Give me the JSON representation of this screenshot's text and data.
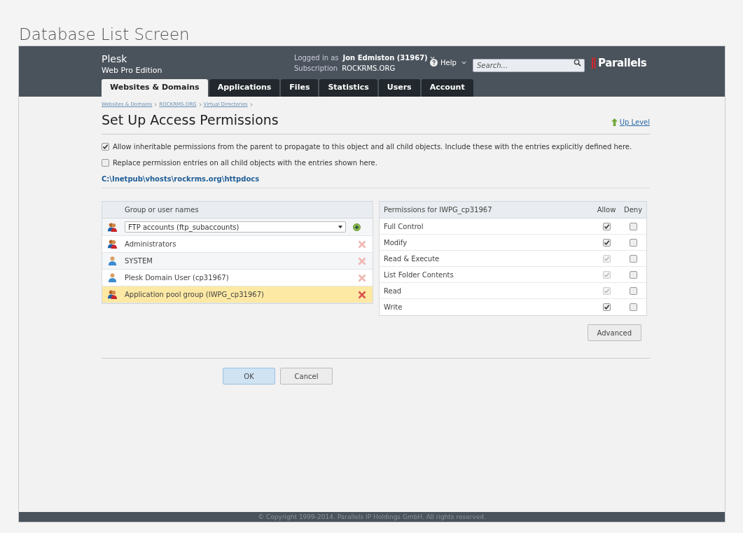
{
  "page_title": "Database List Screen",
  "header": {
    "product": "Plesk",
    "edition": "Web Pro Edition",
    "logged_in_label": "Logged in as",
    "user": "Jon Edmiston (31967)",
    "subscription_label": "Subscription",
    "subscription": "ROCKRMS.ORG",
    "help": "Help",
    "search": {
      "placeholder": "Search..."
    },
    "brand": "Parallels"
  },
  "tabs": [
    {
      "label": "Websites & Domains",
      "selected": true
    },
    {
      "label": "Applications",
      "selected": false
    },
    {
      "label": "Files",
      "selected": false
    },
    {
      "label": "Statistics",
      "selected": false
    },
    {
      "label": "Users",
      "selected": false
    },
    {
      "label": "Account",
      "selected": false
    }
  ],
  "breadcrumbs": [
    "Websites & Domains",
    "ROCKRMS.ORG",
    "Virtual Directories"
  ],
  "title": "Set Up Access Permissions",
  "up_level": "Up Level",
  "options": [
    {
      "label": "Allow inheritable permissions from the parent to propagate to this object and all child objects. Include these with the entries explicitly defined here.",
      "checked": true
    },
    {
      "label": "Replace permission entries on all child objects with the entries shown here.",
      "checked": false
    }
  ],
  "path": "C:\\Inetpub\\vhosts\\rockrms.org\\httpdocs",
  "groups": {
    "header": "Group or user names",
    "select_value": "FTP accounts (ftp_subaccounts)",
    "rows": [
      {
        "name": "Administrators",
        "kind": "group",
        "selected": false
      },
      {
        "name": "SYSTEM",
        "kind": "user",
        "selected": false
      },
      {
        "name": "Plesk Domain User (cp31967)",
        "kind": "user",
        "selected": false
      },
      {
        "name": "Application pool group (IWPG_cp31967)",
        "kind": "group",
        "selected": true
      }
    ]
  },
  "permissions": {
    "header": "Permissions for IWPG_cp31967",
    "allow_label": "Allow",
    "deny_label": "Deny",
    "rows": [
      {
        "name": "Full Control",
        "allow": true,
        "allow_disabled": false,
        "deny": false
      },
      {
        "name": "Modify",
        "allow": true,
        "allow_disabled": false,
        "deny": false
      },
      {
        "name": "Read & Execute",
        "allow": true,
        "allow_disabled": true,
        "deny": false
      },
      {
        "name": "List Folder Contents",
        "allow": true,
        "allow_disabled": true,
        "deny": false
      },
      {
        "name": "Read",
        "allow": true,
        "allow_disabled": true,
        "deny": false
      },
      {
        "name": "Write",
        "allow": true,
        "allow_disabled": false,
        "deny": false
      }
    ]
  },
  "advanced": "Advanced",
  "buttons": [
    "OK",
    "Cancel"
  ],
  "footer": "© Copyright 1999-2014. Parallels IP Holdings GmbH. All rights reserved."
}
